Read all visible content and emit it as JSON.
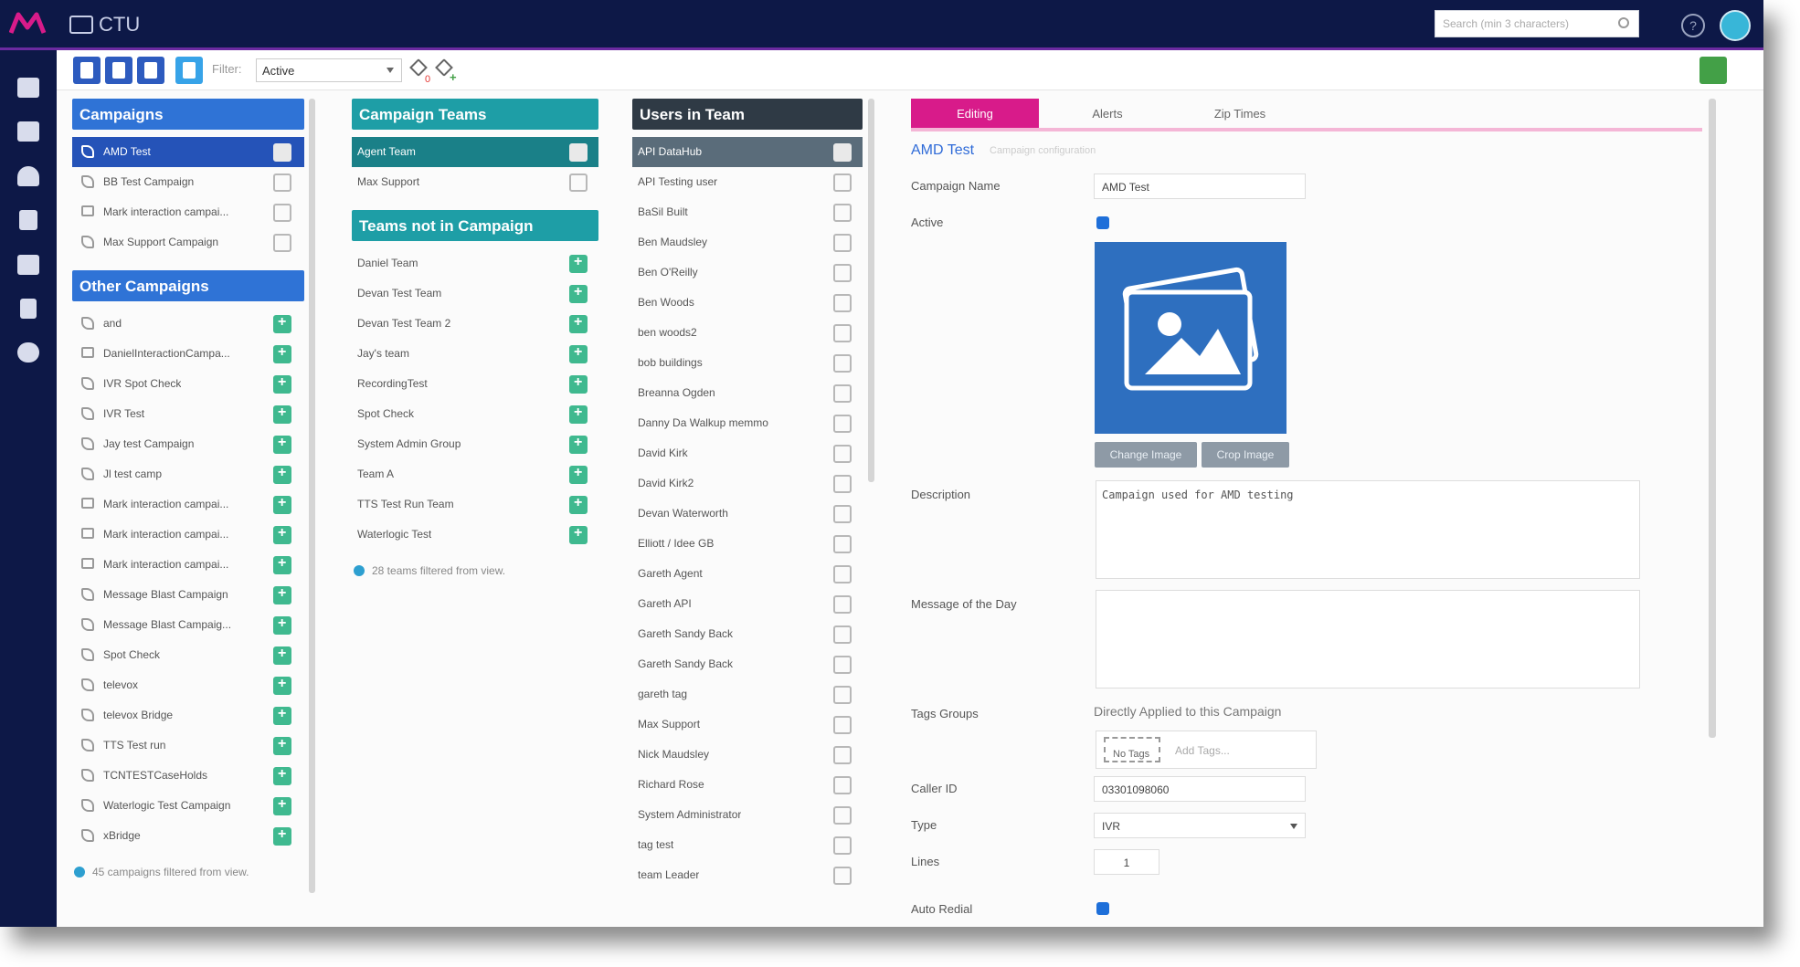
{
  "app": {
    "title": "CTU",
    "search_placeholder": "Search (min 3 characters)"
  },
  "toolbar": {
    "filter_label": "Filter:",
    "filter_value": "Active",
    "tag_count": "0",
    "tag_add": "+"
  },
  "campaigns": {
    "header": "Campaigns",
    "items": [
      {
        "label": "AMD Test",
        "icon": "phone-icon"
      },
      {
        "label": "BB Test Campaign",
        "icon": "phone-icon"
      },
      {
        "label": "Mark interaction campai...",
        "icon": "chat-icon"
      },
      {
        "label": "Max Support Campaign",
        "icon": "phone-icon"
      }
    ]
  },
  "other_campaigns": {
    "header": "Other Campaigns",
    "items": [
      {
        "label": "and",
        "icon": "phone-icon"
      },
      {
        "label": "DanielInteractionCampa...",
        "icon": "chat-icon"
      },
      {
        "label": "IVR Spot Check",
        "icon": "phone-icon"
      },
      {
        "label": "IVR Test",
        "icon": "phone-icon"
      },
      {
        "label": "Jay test Campaign",
        "icon": "phone-icon"
      },
      {
        "label": "Jl test camp",
        "icon": "phone-icon"
      },
      {
        "label": "Mark interaction campai...",
        "icon": "chat-icon"
      },
      {
        "label": "Mark interaction campai...",
        "icon": "chat-icon"
      },
      {
        "label": "Mark interaction campai...",
        "icon": "chat-icon"
      },
      {
        "label": "Message Blast Campaign",
        "icon": "phone-icon"
      },
      {
        "label": "Message Blast Campaig...",
        "icon": "phone-icon"
      },
      {
        "label": "Spot Check",
        "icon": "phone-icon"
      },
      {
        "label": "televox",
        "icon": "phone-icon"
      },
      {
        "label": "televox Bridge",
        "icon": "phone-icon"
      },
      {
        "label": "TTS Test run",
        "icon": "phone-icon"
      },
      {
        "label": "TCNTESTCaseHolds",
        "icon": "phone-icon"
      },
      {
        "label": "Waterlogic Test Campaign",
        "icon": "phone-icon"
      },
      {
        "label": "xBridge",
        "icon": "phone-icon"
      }
    ],
    "footnote": "45 campaigns filtered from view."
  },
  "campaign_teams": {
    "header": "Campaign Teams",
    "items": [
      {
        "label": "Agent Team"
      },
      {
        "label": "Max Support"
      }
    ]
  },
  "teams_not_in_campaign": {
    "header": "Teams not in Campaign",
    "items": [
      {
        "label": "Daniel Team"
      },
      {
        "label": "Devan Test Team"
      },
      {
        "label": "Devan Test Team 2"
      },
      {
        "label": "Jay's team"
      },
      {
        "label": "RecordingTest"
      },
      {
        "label": "Spot Check"
      },
      {
        "label": "System Admin Group"
      },
      {
        "label": "Team A"
      },
      {
        "label": "TTS Test Run Team"
      },
      {
        "label": "Waterlogic Test"
      }
    ],
    "footnote": "28 teams filtered from view."
  },
  "users_in_team": {
    "header": "Users in Team",
    "items": [
      {
        "label": "API DataHub"
      },
      {
        "label": "API Testing user"
      },
      {
        "label": "BaSil Built"
      },
      {
        "label": "Ben Maudsley"
      },
      {
        "label": "Ben O'Reilly"
      },
      {
        "label": "Ben Woods"
      },
      {
        "label": "ben woods2"
      },
      {
        "label": "bob buildings"
      },
      {
        "label": "Breanna Ogden"
      },
      {
        "label": "Danny Da Walkup memmo"
      },
      {
        "label": "David Kirk"
      },
      {
        "label": "David Kirk2"
      },
      {
        "label": "Devan Waterworth"
      },
      {
        "label": "Elliott / Idee GB"
      },
      {
        "label": "Gareth Agent"
      },
      {
        "label": "Gareth API"
      },
      {
        "label": "Gareth Sandy Back"
      },
      {
        "label": "Gareth Sandy Back"
      },
      {
        "label": "gareth tag"
      },
      {
        "label": "Max Support"
      },
      {
        "label": "Nick Maudsley"
      },
      {
        "label": "Richard Rose"
      },
      {
        "label": "System Administrator"
      },
      {
        "label": "tag test"
      },
      {
        "label": "team Leader"
      }
    ]
  },
  "editor": {
    "tabs": [
      "Editing",
      "Alerts",
      "Zip Times"
    ],
    "heading": "AMD Test",
    "subnote": "Campaign configuration",
    "labels": {
      "name": "Campaign Name",
      "active": "Active",
      "description": "Description",
      "motd": "Message of the Day",
      "tag_groups": "Tags Groups",
      "caller_id": "Caller ID",
      "type": "Type",
      "lines": "Lines",
      "auto_redial": "Auto Redial"
    },
    "values": {
      "name": "AMD Test",
      "description": "Campaign used for AMD testing",
      "motd": "",
      "caller_id": "03301098060",
      "type": "IVR",
      "lines": "1"
    },
    "image_buttons": [
      "Change Image",
      "Crop Image"
    ],
    "tags_applied": "Directly Applied to this Campaign",
    "tag_chip": "No Tags",
    "tag_placeholder": "Add Tags..."
  },
  "colors": {
    "nav": "#0d1847",
    "campaigns_header": "#2f73d6",
    "teams_header": "#1e9ea6",
    "users_header": "#2f3a45",
    "tab_active": "#d81b8a",
    "add_green": "#3fb98f"
  }
}
